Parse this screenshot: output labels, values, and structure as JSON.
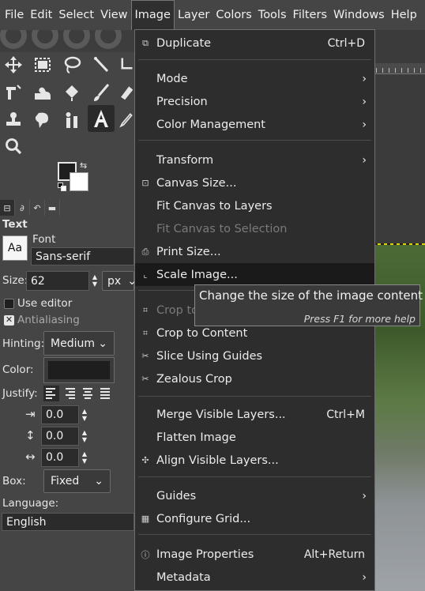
{
  "menubar": {
    "items": [
      "File",
      "Edit",
      "Select",
      "View",
      "Image",
      "Layer",
      "Colors",
      "Tools",
      "Filters",
      "Windows",
      "Help"
    ],
    "active": "Image"
  },
  "tool_options": {
    "title": "Text",
    "font_label": "Font",
    "font_preview": "Aa",
    "font_value": "Sans-serif",
    "size_label": "Size:",
    "size_value": "62",
    "size_unit": "px",
    "use_editor_label": "Use editor",
    "antialiasing_label": "Antialiasing",
    "hinting_label": "Hinting:",
    "hinting_value": "Medium",
    "color_label": "Color:",
    "color_value": "#1e1e1e",
    "justify_label": "Justify:",
    "indent_value": "0.0",
    "line_spacing_value": "0.0",
    "letter_spacing_value": "0.0",
    "box_label": "Box:",
    "box_value": "Fixed",
    "language_label": "Language:",
    "language_value": "English"
  },
  "colors": {
    "foreground": "#1e1e1e",
    "background": "#ffffff"
  },
  "image_menu": {
    "duplicate": {
      "label": "Duplicate",
      "accel": "Ctrl+D"
    },
    "mode": "Mode",
    "precision": "Precision",
    "color_management": "Color Management",
    "transform": "Transform",
    "canvas_size": "Canvas Size...",
    "fit_canvas_to_layers": "Fit Canvas to Layers",
    "fit_canvas_to_selection": "Fit Canvas to Selection",
    "print_size": "Print Size...",
    "scale_image": "Scale Image...",
    "crop_to_selection": "Crop to",
    "crop_to_content": "Crop to Content",
    "slice_using_guides": "Slice Using Guides",
    "zealous_crop": "Zealous Crop",
    "merge_visible_layers": {
      "label": "Merge Visible Layers...",
      "accel": "Ctrl+M"
    },
    "flatten_image": "Flatten Image",
    "align_visible_layers": "Align Visible Layers...",
    "guides": "Guides",
    "configure_grid": "Configure Grid...",
    "image_properties": {
      "label": "Image Properties",
      "accel": "Alt+Return"
    },
    "metadata": "Metadata"
  },
  "tooltip": {
    "text": "Change the size of the image content",
    "help": "Press F1 for more help"
  }
}
